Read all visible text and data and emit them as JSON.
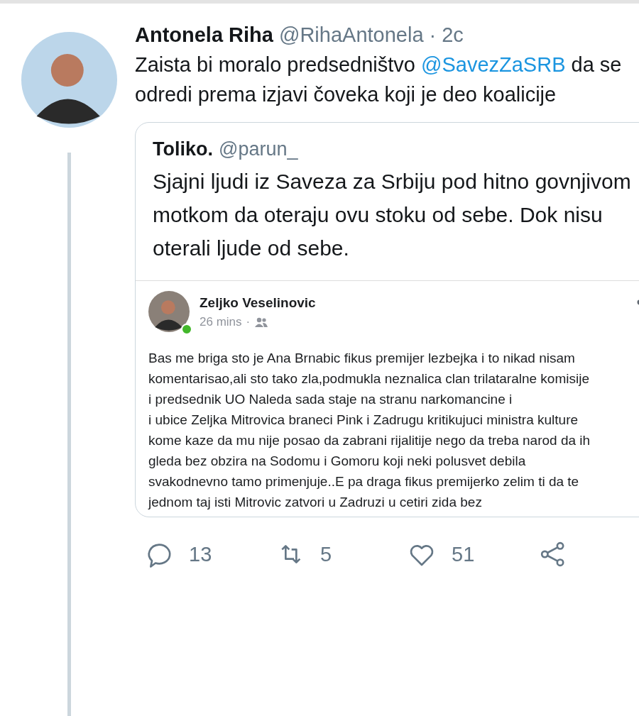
{
  "tweet": {
    "name": "Antonela Riha",
    "handle": "@RihaAntonela",
    "separator": "·",
    "time": "2c",
    "text": "Zaista bi moralo predsedništvo ",
    "mention": "@SavezZaSRB",
    "text_after": " da se odredi prema izjavi čoveka koji je deo koalicije",
    "quote": {
      "name": "Toliko.",
      "handle": "@parun_",
      "text": "Sjajni ljudi iz Saveza za Srbiju pod hitno govnjivom motkom da oteraju ovu stoku od sebe. Dok nisu oterali ljude od sebe.",
      "post": {
        "author": "Zeljko Veselinovic",
        "online": true,
        "time": "26 mins",
        "separator": "·",
        "paragraphs": [
          "Bas me briga sto je Ana Brnabic fikus premijer lezbejka i to nikad nisam komentarisao,ali sto tako zla,podmukla neznalica clan trilataralne komisije i predsednik UO Naleda sada staje na stranu narkomancine i",
          "i ubice Zeljka Mitrovica braneci Pink i Zadrugu kritikujuci ministra kulture kome kaze da mu nije posao da zabrani rijalitije nego da treba narod da ih gleda bez obzira na Sodomu i Gomoru koji neki polusvet debila svakodnevno tamo primenjuje..E pa draga fikus premijerko zelim ti da te jednom taj isti Mitrovic zatvori u Zadruzi u cetiri zida bez"
        ]
      }
    },
    "actions": [
      {
        "kind": "reply",
        "count": "13"
      },
      {
        "kind": "retweet",
        "count": "5"
      },
      {
        "kind": "like",
        "count": "51"
      },
      {
        "kind": "share"
      }
    ]
  }
}
